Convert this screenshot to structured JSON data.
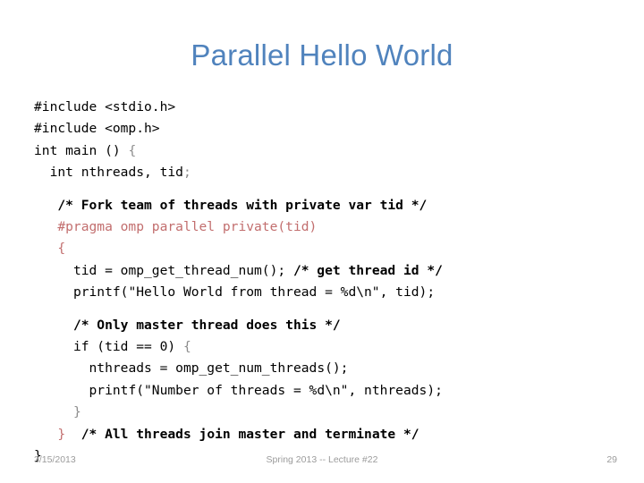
{
  "slide": {
    "title": "Parallel Hello World",
    "title_color": "#5083bd",
    "background": "#ffffff"
  },
  "code": {
    "language": "c",
    "colors": {
      "plain": "#000000",
      "gray": "#8c8c8c",
      "red": "#b4484a",
      "red_light": "#c26e6e",
      "bold": "#000000"
    },
    "lines": [
      {
        "indent": "",
        "segments": [
          {
            "text": "#include <stdio.h>",
            "style": "plain"
          }
        ]
      },
      {
        "indent": "",
        "segments": [
          {
            "text": "#include <omp.h>",
            "style": "plain"
          }
        ]
      },
      {
        "indent": "",
        "segments": [
          {
            "text": "int main () ",
            "style": "plain"
          },
          {
            "text": "{",
            "style": "gray"
          }
        ]
      },
      {
        "indent": "  ",
        "segments": [
          {
            "text": "int nthreads, tid",
            "style": "plain"
          },
          {
            "text": ";",
            "style": "gray"
          }
        ]
      },
      {
        "indent": "",
        "blank": true,
        "segments": []
      },
      {
        "indent": "   ",
        "segments": [
          {
            "text": "/* Fork team of threads with private var tid */",
            "style": "bold"
          }
        ]
      },
      {
        "indent": "   ",
        "segments": [
          {
            "text": "#pragma omp parallel private(tid)",
            "style": "red_light"
          }
        ]
      },
      {
        "indent": "   ",
        "segments": [
          {
            "text": "{",
            "style": "red_light"
          }
        ]
      },
      {
        "indent": "     ",
        "segments": [
          {
            "text": "tid = omp_get_thread_num(); ",
            "style": "plain"
          },
          {
            "text": "/* get thread id */",
            "style": "bold"
          }
        ]
      },
      {
        "indent": "     ",
        "segments": [
          {
            "text": "printf(\"Hello World from thread = %d\\n\", tid);",
            "style": "plain"
          }
        ]
      },
      {
        "indent": "",
        "blank": true,
        "segments": []
      },
      {
        "indent": "     ",
        "segments": [
          {
            "text": "/* Only master thread does this */",
            "style": "bold"
          }
        ]
      },
      {
        "indent": "     ",
        "segments": [
          {
            "text": "if (tid == 0) ",
            "style": "plain"
          },
          {
            "text": "{",
            "style": "gray"
          }
        ]
      },
      {
        "indent": "       ",
        "segments": [
          {
            "text": "nthreads = omp_get_num_threads();",
            "style": "plain"
          }
        ]
      },
      {
        "indent": "       ",
        "segments": [
          {
            "text": "printf(\"Number of threads = %d\\n\", nthreads);",
            "style": "plain"
          }
        ]
      },
      {
        "indent": "     ",
        "segments": [
          {
            "text": "}",
            "style": "gray"
          }
        ]
      },
      {
        "indent": "   ",
        "segments": [
          {
            "text": "}",
            "style": "red_light"
          },
          {
            "text": "  ",
            "style": "plain"
          },
          {
            "text": "/* All threads join master and terminate */",
            "style": "bold"
          }
        ]
      },
      {
        "indent": "",
        "segments": [
          {
            "text": "}",
            "style": "plain"
          }
        ]
      }
    ]
  },
  "footer": {
    "date": "3/15/2013",
    "center": "Spring 2013 -- Lecture #22",
    "page": "29"
  }
}
